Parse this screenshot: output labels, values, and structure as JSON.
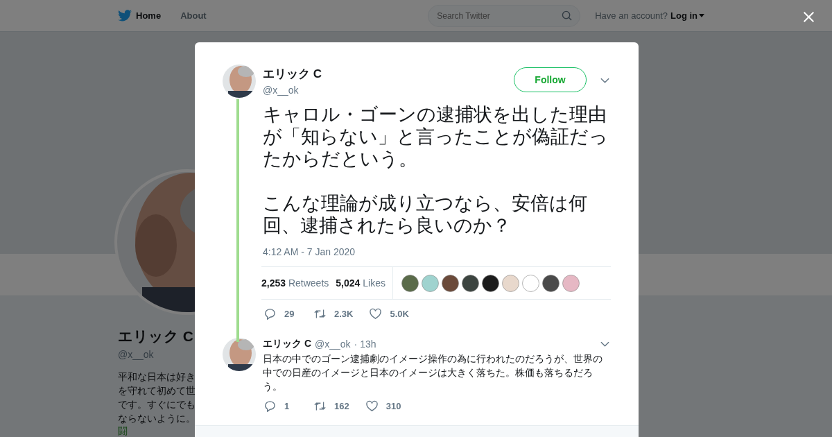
{
  "topbar": {
    "nav": [
      {
        "label": "Home",
        "selected": true
      },
      {
        "label": "About",
        "selected": false
      }
    ],
    "search": {
      "placeholder": "Search Twitter"
    },
    "account_prompt": "Have an account?",
    "login": "Log in"
  },
  "profile": {
    "name": "エリック C",
    "handle": "@x__ok",
    "bio_lines": [
      "平和な日本は好き",
      "を守れて初めて世",
      "です。すぐにでも",
      "ならないように。"
    ],
    "bio_tag": "闘"
  },
  "modal": {
    "tweet": {
      "name": "エリック C",
      "handle": "@x__ok",
      "follow": "Follow",
      "paragraphs": [
        "キャロル・ゴーンの逮捕状を出した理由が「知らない」と言ったことが偽証だったからだという。",
        "こんな理論が成り立つなら、安倍は何回、逮捕されたら良いのか？"
      ],
      "time": "4:12 AM - 7 Jan 2020",
      "retweets": {
        "count": "2,253",
        "label": "Retweets"
      },
      "likes": {
        "count": "5,024",
        "label": "Likes"
      },
      "likers": [
        {
          "color": "#5a6b4a"
        },
        {
          "color": "#9fd3cf"
        },
        {
          "color": "#6b4a3a"
        },
        {
          "color": "#3c4440"
        },
        {
          "color": "#1c1c1c"
        },
        {
          "color": "#e8d8cc"
        },
        {
          "color": "#ffffff"
        },
        {
          "color": "#4a4a4a"
        },
        {
          "color": "#e6b8c4"
        }
      ],
      "actions": {
        "replies": "29",
        "retweets": "2.3K",
        "likes": "5.0K"
      }
    },
    "reply": {
      "name": "エリック C",
      "handle": "@x__ok",
      "age": "· 13h",
      "text": "日本の中でのゴーン逮捕劇のイメージ操作の為に行われたのだろうが、世界の中での日産のイメージと日本のイメージは大きく落ちた。株価も落ちるだろう。",
      "actions": {
        "replies": "1",
        "retweets": "162",
        "likes": "310"
      }
    }
  }
}
